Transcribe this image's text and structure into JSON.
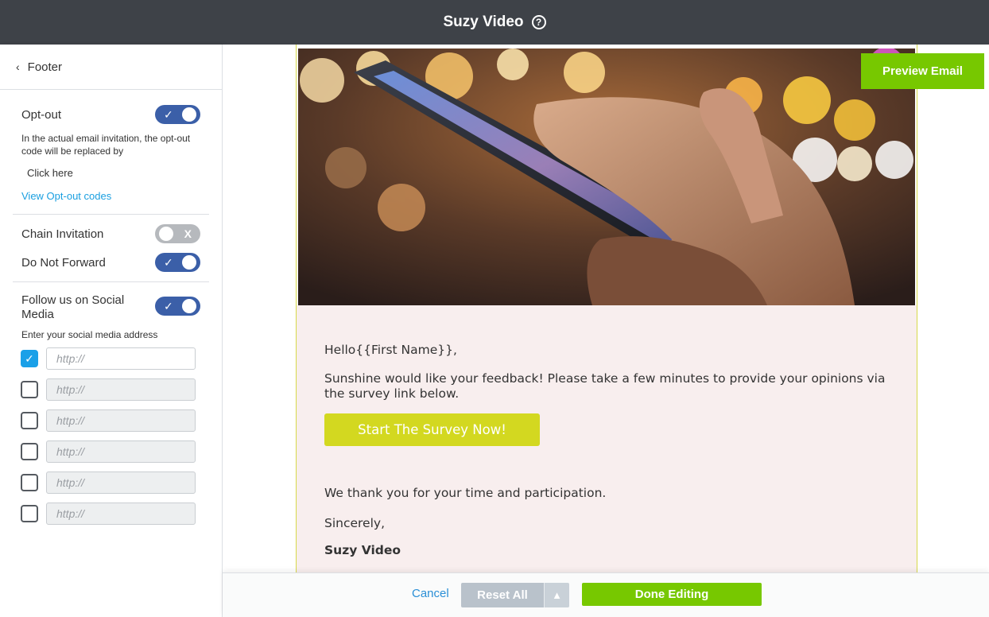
{
  "header": {
    "title": "Suzy Video",
    "help_icon": "?"
  },
  "sidebar": {
    "back_icon": "‹",
    "section_title": "Footer",
    "opt_out": {
      "label": "Opt-out",
      "enabled": true,
      "note": "In the actual email invitation, the opt-out code will be replaced by",
      "placeholder_text": "Click here",
      "link": "View Opt-out codes"
    },
    "chain_invitation": {
      "label": "Chain Invitation",
      "enabled": false
    },
    "do_not_forward": {
      "label": "Do Not Forward",
      "enabled": true
    },
    "social": {
      "label": "Follow us on Social Media",
      "enabled": true,
      "instruction": "Enter your social media address",
      "inputs": [
        {
          "checked": true,
          "placeholder": "http://"
        },
        {
          "checked": false,
          "placeholder": "http://"
        },
        {
          "checked": false,
          "placeholder": "http://"
        },
        {
          "checked": false,
          "placeholder": "http://"
        },
        {
          "checked": false,
          "placeholder": "http://"
        },
        {
          "checked": false,
          "placeholder": "http://"
        }
      ]
    }
  },
  "toggle_marks": {
    "on": "✓",
    "off": "X"
  },
  "email": {
    "greeting": "Hello{{First Name}},",
    "message": "Sunshine would like your feedback! Please take a few minutes to provide your opinions via the survey link below.",
    "cta": "Start The Survey Now!",
    "thanks": "We thank you for your time and participation.",
    "signoff": "Sincerely,",
    "signature": "Suzy Video"
  },
  "preview_button": "Preview Email",
  "footer": {
    "cancel": "Cancel",
    "reset_all": "Reset All",
    "reset_caret": "▲",
    "done": "Done Editing"
  },
  "colors": {
    "topbar": "#3e4248",
    "toggle_on": "#3b5fa8",
    "toggle_off": "#b6b9bd",
    "link": "#1a9fe0",
    "cta": "#d3d820",
    "green": "#77c800",
    "email_bg": "#f8eeee"
  }
}
